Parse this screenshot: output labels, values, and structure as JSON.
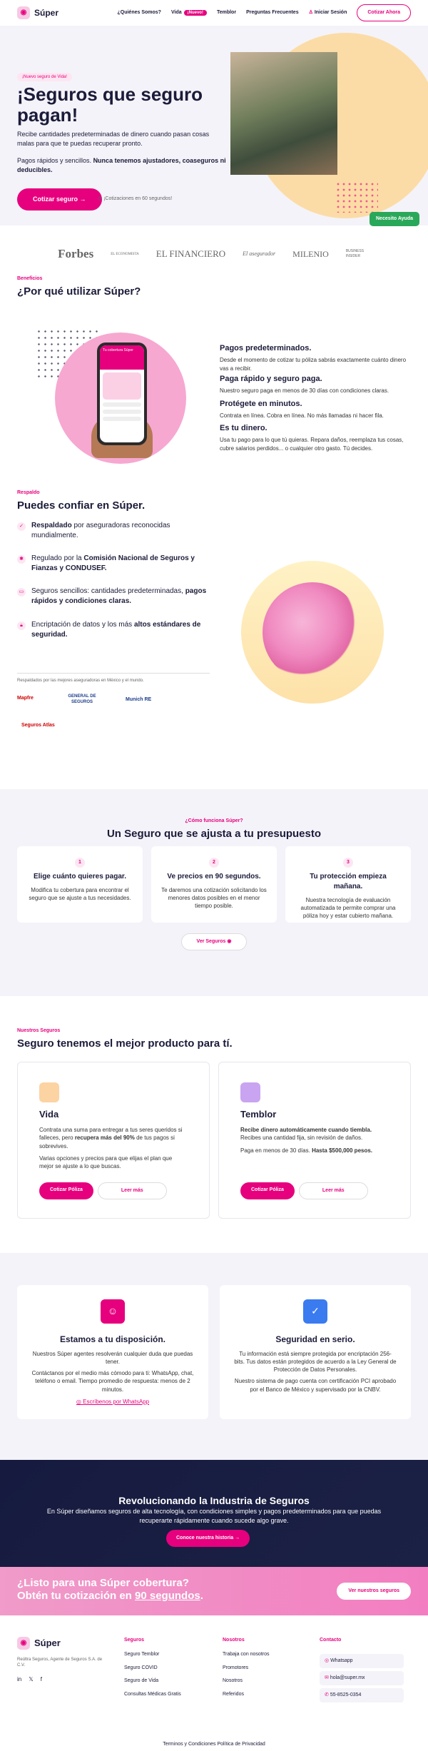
{
  "header": {
    "logo": "Súper",
    "nav": [
      "¿Quiénes Somos?",
      "Vida",
      "Temblor",
      "Preguntas Frecuentes",
      "Iniciar Sesión"
    ],
    "new_badge": "¡Nuevo!",
    "cta": "Cotizar Ahora"
  },
  "hero": {
    "pill": "¡Nuevo seguro de Vida!",
    "title": "¡Seguros que seguro pagan!",
    "p1": "Recibe cantidades predeterminadas de dinero cuando pasan cosas malas para que te puedas recuperar pronto.",
    "p2a": "Pagos rápidos y sencillos. ",
    "p2b": "Nunca tenemos ajustadores, coaseguros ni deducibles.",
    "cta": "Cotizar seguro",
    "note": "¡Cotizaciones en 60 segundos!",
    "help": "Necesito Ayuda"
  },
  "press": [
    "Forbes",
    "EL ECONOMISTA",
    "EL FINANCIERO",
    "El asegurador",
    "MILENIO",
    "BUSINESS INSIDER"
  ],
  "why": {
    "eyebrow": "Beneficios",
    "title": "¿Por qué utilizar Súper?",
    "phone": "Tu cobertura Súper",
    "features": [
      {
        "t": "Pagos predeterminados.",
        "d": "Desde el momento de cotizar tu póliza sabrás exactamente cuánto dinero vas a recibir."
      },
      {
        "t": "Paga rápido y seguro paga.",
        "d": "Nuestro seguro paga en menos de 30 días con condiciones claras."
      },
      {
        "t": "Protégete en minutos.",
        "d": "Contrata en línea. Cobra en línea. No más llamadas ni hacer fila."
      },
      {
        "t": "Es tu dinero.",
        "d": "Usa tu pago para lo que tú quieras. Repara daños, reemplaza tus cosas, cubre salarios perdidos... o cualquier otro gasto. Tú decides."
      }
    ]
  },
  "trust": {
    "eyebrow": "Respaldo",
    "title": "Puedes confiar en Súper.",
    "i1b": "Respaldado",
    "i1": " por aseguradoras reconocidas mundialmente.",
    "i2": "Regulado por la ",
    "i2b": "Comisión Nacional de Seguros y Fianzas y CONDUSEF.",
    "i3": "Seguros sencillos: cantidades predeterminadas, ",
    "i3b": "pagos rápidos y condiciones claras.",
    "i4": "Encriptación de datos y los más ",
    "i4b": "altos estándares de seguridad.",
    "sub": "Respaldados por las mejores aseguradoras en México y el mundo.",
    "insurers": [
      "Mapfre",
      "GENERAL DE SEGUROS",
      "Munich RE",
      "Seguros Atlas"
    ]
  },
  "how": {
    "eyebrow": "¿Cómo funciona Súper?",
    "title": "Un Seguro que se ajusta a tu presupuesto",
    "steps": [
      {
        "n": "1",
        "t": "Elige cuánto quieres pagar.",
        "d": "Modifica tu cobertura para encontrar el seguro que se ajuste a tus necesidades."
      },
      {
        "n": "2",
        "t": "Ve precios en 90 segundos.",
        "d": "Te daremos una cotización solicitando los menores datos posibles en el menor tiempo posible."
      },
      {
        "n": "3",
        "t": "Tu protección empieza mañana.",
        "d": "Nuestra tecnología de evaluación automatizada te permite comprar una póliza hoy y estar cubierto mañana."
      }
    ],
    "btn": "Ver Seguros"
  },
  "prod": {
    "eyebrow": "Nuestros Seguros",
    "title": "Seguro tenemos el mejor producto para tí.",
    "vida": {
      "t": "Vida",
      "d1": "Contrata una suma para entregar a tus seres queridos si falleces, pero ",
      "d1b": "recupera más del 90%",
      "d1c": " de tus pagos si sobrevives.",
      "d2": "Varias opciones y precios para que elijas el plan que mejor se ajuste a lo que buscas."
    },
    "temblor": {
      "t": "Temblor",
      "d1b": "Recibe dinero automáticamente cuando tiembla.",
      "d1": " Recibes una cantidad fija, sin revisión de daños.",
      "d2": "Paga en menos de 30 días. ",
      "d2b": "Hasta $500,000 pesos."
    },
    "quote": "Cotizar Póliza",
    "more": "Leer más"
  },
  "sup": {
    "a": {
      "t": "Estamos a tu disposición.",
      "d1": "Nuestros Súper agentes resolverán cualquier duda que puedas tener.",
      "d2": "Contáctanos por el medio más cómodo para ti: WhatsApp, chat, teléfono o email. Tiempo promedio de respuesta: menos de 2 minutos.",
      "link": "Escríbenos por WhatsApp"
    },
    "b": {
      "t": "Seguridad en serio.",
      "d1": "Tu información está siempre protegida por encriptación 256-bits. Tus datos están protegidos de acuerdo a la Ley General de Protección de Datos Personales.",
      "d2": "Nuestro sistema de pago cuenta con certificación PCI aprobado por el Banco de México y supervisado por la CNBV."
    }
  },
  "dark": {
    "t": "Revolucionando la Industria de Seguros",
    "d": "En Súper diseñamos seguros de alta tecnología, con condiciones simples y pagos predeterminados para que puedas recuperarte rápidamente cuando sucede algo grave.",
    "btn": "Conoce nuestra historia"
  },
  "banner": {
    "l1": "¿Listo para una Súper cobertura?",
    "l2a": "Obtén tu cotización en ",
    "l2b": "90 segundos",
    "l2c": ".",
    "btn": "Ver nuestros seguros"
  },
  "footer": {
    "logo": "Súper",
    "legal": "Reúltra Seguros, Agente de Seguros S.A. de C.V.",
    "c1": {
      "h": "Seguros",
      "items": [
        "Seguro Temblor",
        "Seguro COVID",
        "Seguro de Vida",
        "Consultas Médicas Gratis"
      ]
    },
    "c2": {
      "h": "Nosotros",
      "items": [
        "Trabaja con nosotros",
        "Promotores",
        "Nosotros",
        "Referidos"
      ]
    },
    "c3": {
      "h": "Contacto",
      "items": [
        "Whatsapp",
        "hola@super.mx",
        "55-8525-0354"
      ]
    },
    "bottom": [
      "Terminos y Condiciones",
      "Política de Privacidad"
    ]
  }
}
